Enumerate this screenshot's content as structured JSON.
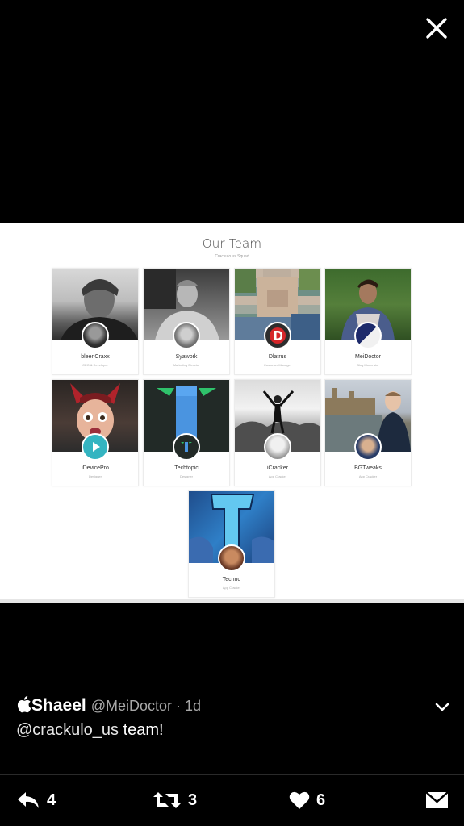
{
  "viewer": {
    "close_icon": "close-icon"
  },
  "slide": {
    "title": "Our Team",
    "subtitle": "Crackulo.us Squad",
    "members": [
      {
        "name": "bleenCraxx",
        "role": "CEO & Developer"
      },
      {
        "name": "Syawork",
        "role": "Marketing Director"
      },
      {
        "name": "Dlatrus",
        "role": "Customer Manager"
      },
      {
        "name": "MeiDoctor",
        "role": "Blog Moderator"
      },
      {
        "name": "iDevicePro",
        "role": "Designer"
      },
      {
        "name": "Techtopic",
        "role": "Designer"
      },
      {
        "name": "iCracker",
        "role": "App Cracker"
      },
      {
        "name": "BGTweaks",
        "role": "App Cracker"
      },
      {
        "name": "Techno",
        "role": "App Cracker"
      }
    ]
  },
  "tweet": {
    "author_name": "Shaeel",
    "handle_time": "@MeiDoctor · 1d",
    "mention": "@crackulo_us",
    "text_rest": " team!"
  },
  "actions": {
    "reply_count": "4",
    "retweet_count": "3",
    "like_count": "6"
  },
  "colors": {
    "background": "#000000",
    "text": "#ffffff",
    "handle": "#a7a7a7"
  }
}
